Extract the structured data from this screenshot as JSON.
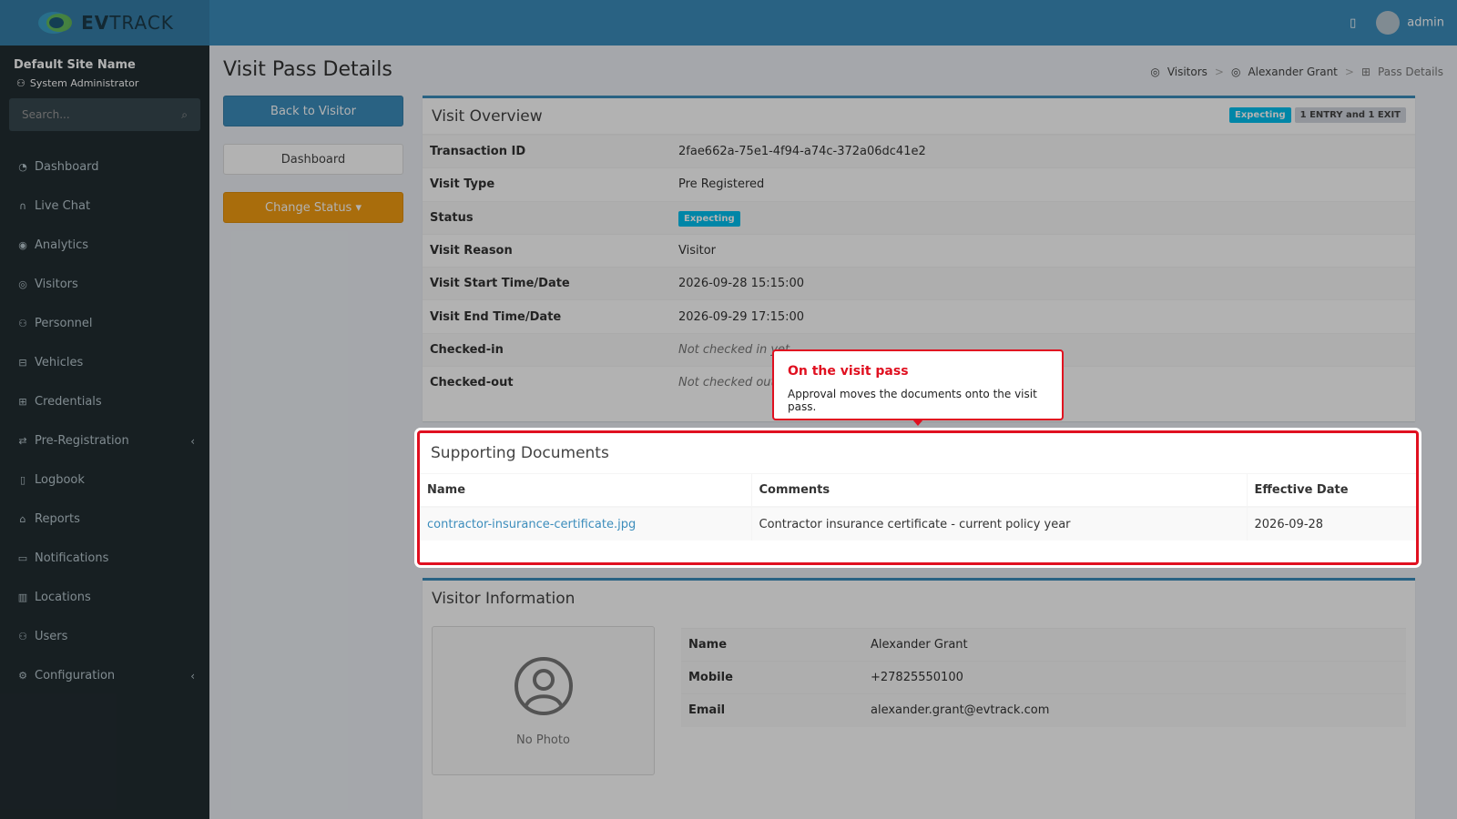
{
  "brand": {
    "logo_text_bold": "EV",
    "logo_text": "TRACK",
    "user": "admin"
  },
  "sidebar": {
    "site_name": "Default Site Name",
    "role": "System Administrator",
    "search_placeholder": "Search...",
    "items": [
      {
        "label": "Dashboard",
        "icon": "dashboard-icon"
      },
      {
        "label": "Live Chat",
        "icon": "headset-icon"
      },
      {
        "label": "Analytics",
        "icon": "analytics-icon"
      },
      {
        "label": "Visitors",
        "icon": "eye-icon"
      },
      {
        "label": "Personnel",
        "icon": "personnel-icon"
      },
      {
        "label": "Vehicles",
        "icon": "car-icon"
      },
      {
        "label": "Credentials",
        "icon": "credential-icon"
      },
      {
        "label": "Pre-Registration",
        "icon": "exchange-icon"
      },
      {
        "label": "Logbook",
        "icon": "book-icon"
      },
      {
        "label": "Reports",
        "icon": "reports-icon"
      },
      {
        "label": "Notifications",
        "icon": "chat-icon"
      },
      {
        "label": "Locations",
        "icon": "map-icon"
      },
      {
        "label": "Users",
        "icon": "users-icon"
      },
      {
        "label": "Configuration",
        "icon": "cog-icon"
      }
    ]
  },
  "page": {
    "title": "Visit Pass Details",
    "breadcrumb": [
      "Visitors",
      "Alexander Grant",
      "Pass Details"
    ],
    "buttons": {
      "back": "Back to Visitor",
      "dashboard": "Dashboard",
      "change_status": "Change Status ▾"
    }
  },
  "overview": {
    "title": "Visit Overview",
    "badge_status": "Expecting",
    "badge_mode": "1 ENTRY and 1 EXIT",
    "rows": [
      {
        "k": "Transaction ID",
        "v": "2fae662a-75e1-4f94-a74c-372a06dc41e2"
      },
      {
        "k": "Visit Type",
        "v": "Pre Registered"
      },
      {
        "k": "Status",
        "v": "Expecting"
      },
      {
        "k": "Visit Reason",
        "v": "Visitor"
      },
      {
        "k": "Visit Start Time/Date",
        "v": "2026-09-28 15:15:00"
      },
      {
        "k": "Visit End Time/Date",
        "v": "2026-09-29 17:15:00"
      },
      {
        "k": "Checked-in",
        "v": "Not checked in yet"
      },
      {
        "k": "Checked-out",
        "v": "Not checked out yet"
      }
    ]
  },
  "tooltip": {
    "title": "On the visit pass",
    "body": "Approval moves the documents onto the visit pass."
  },
  "documents": {
    "title": "Supporting Documents",
    "columns": [
      "Name",
      "Comments",
      "Effective Date"
    ],
    "rows": [
      {
        "name": "contractor-insurance-certificate.jpg",
        "comments": "Contractor insurance certificate - current policy year",
        "date": "2026-09-28"
      }
    ]
  },
  "visitor": {
    "title": "Visitor Information",
    "no_photo": "No Photo",
    "rows": [
      {
        "k": "Name",
        "v": "Alexander Grant"
      },
      {
        "k": "Mobile",
        "v": "+27825550100"
      },
      {
        "k": "Email",
        "v": "alexander.grant@evtrack.com"
      }
    ]
  },
  "colors": {
    "primary": "#3c8dbc",
    "warning": "#f39c12",
    "info": "#00c0ef",
    "highlight": "#e01020"
  }
}
